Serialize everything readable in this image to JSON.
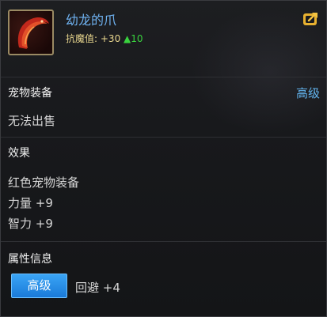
{
  "item": {
    "name": "幼龙的爪",
    "stat_label": "抗魔值:",
    "stat_value": "+30",
    "stat_up": "▲10",
    "icon": "red-claw-icon"
  },
  "header_icon": "share-icon",
  "sections": {
    "pet_equipment": {
      "title": "宠物装备",
      "grade": "高级",
      "line": "无法出售"
    },
    "effects": {
      "title": "效果",
      "lines": [
        "红色宠物装备",
        "力量 +9",
        "智力 +9"
      ]
    },
    "attributes": {
      "title": "属性信息",
      "badge": "高级",
      "stat": "回避 +4"
    }
  },
  "colors": {
    "name": "#6fb3f2",
    "stat_value": "#e8d68e",
    "stat_up": "#39d23e",
    "grade": "#62b4ef",
    "badge": "#1a7ad9"
  }
}
